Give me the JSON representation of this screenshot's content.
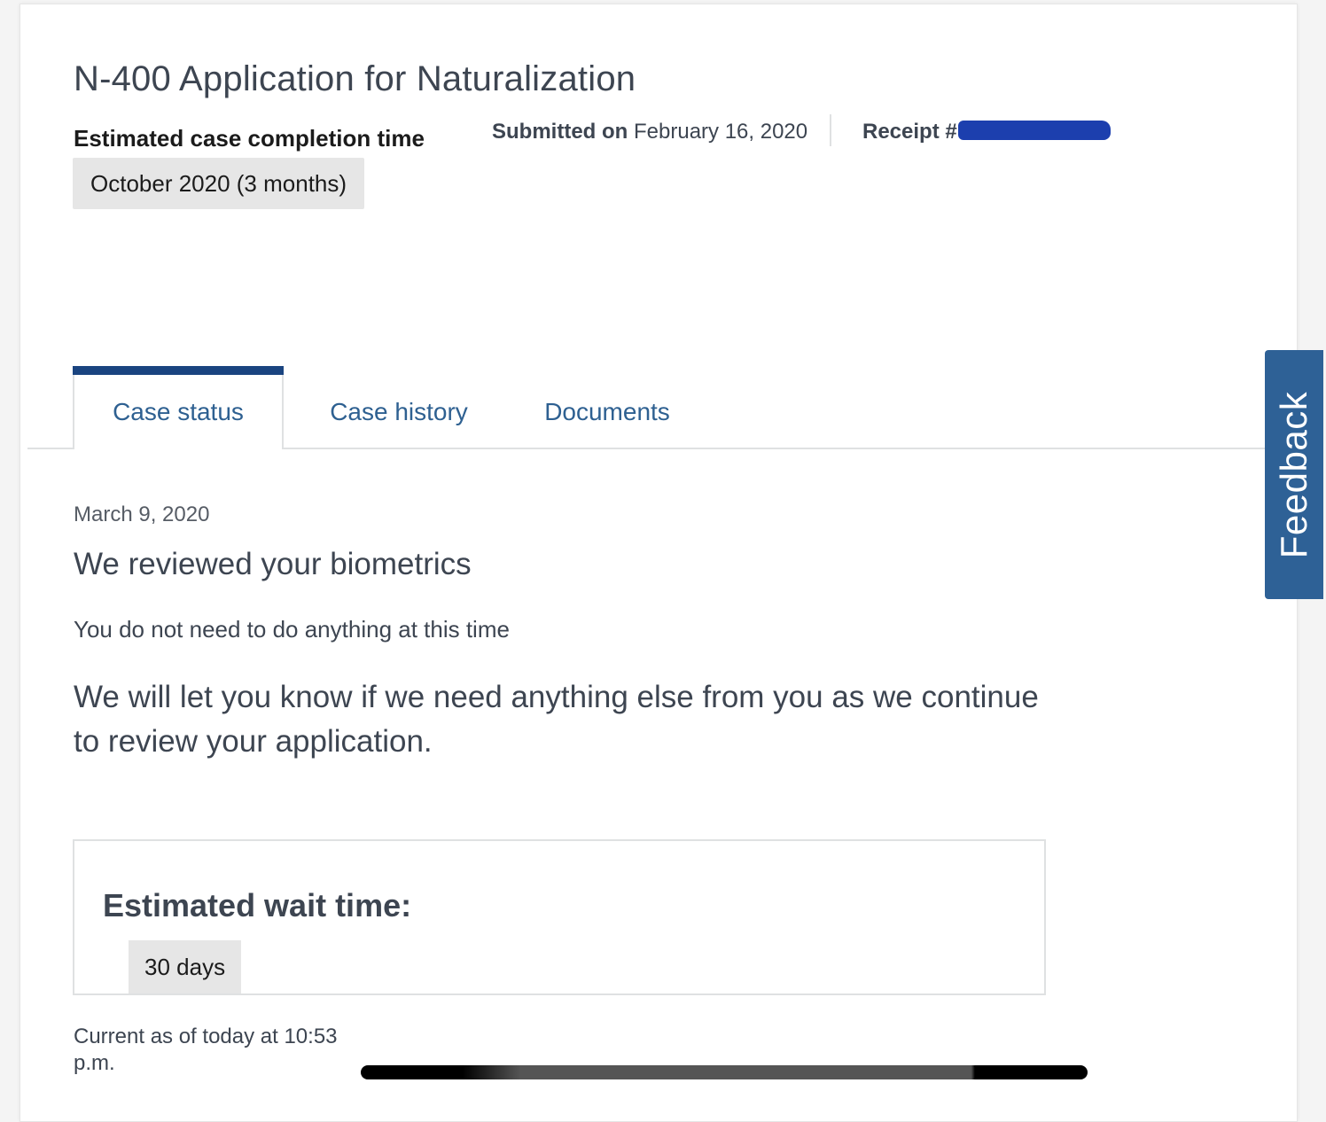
{
  "case": {
    "title": "N-400 Application for Naturalization",
    "estimated_completion_label": "Estimated case completion time",
    "estimated_completion_value": "October 2020 (3 months)",
    "submitted_label": "Submitted on",
    "submitted_date": "February 16, 2020",
    "receipt_label": "Receipt #",
    "receipt_redacted": true
  },
  "tabs": [
    {
      "label": "Case status",
      "active": true
    },
    {
      "label": "Case history",
      "active": false
    },
    {
      "label": "Documents",
      "active": false
    }
  ],
  "status": {
    "date": "March 9, 2020",
    "heading": "We reviewed your biometrics",
    "subheading": "You do not need to do anything at this time",
    "body": "We will let you know if we need anything else from you as we continue to review your application."
  },
  "wait": {
    "label": "Estimated wait time:",
    "value": "30 days"
  },
  "footer": {
    "current_as_of": "Current as of today at 10:53 p.m."
  },
  "feedback": {
    "label": "Feedback"
  },
  "colors": {
    "accent": "#1a4480",
    "tab_link": "#2e6091",
    "feedback_bg": "#2e6196",
    "redaction": "#1c3fae",
    "badge_bg": "#e6e6e6"
  }
}
